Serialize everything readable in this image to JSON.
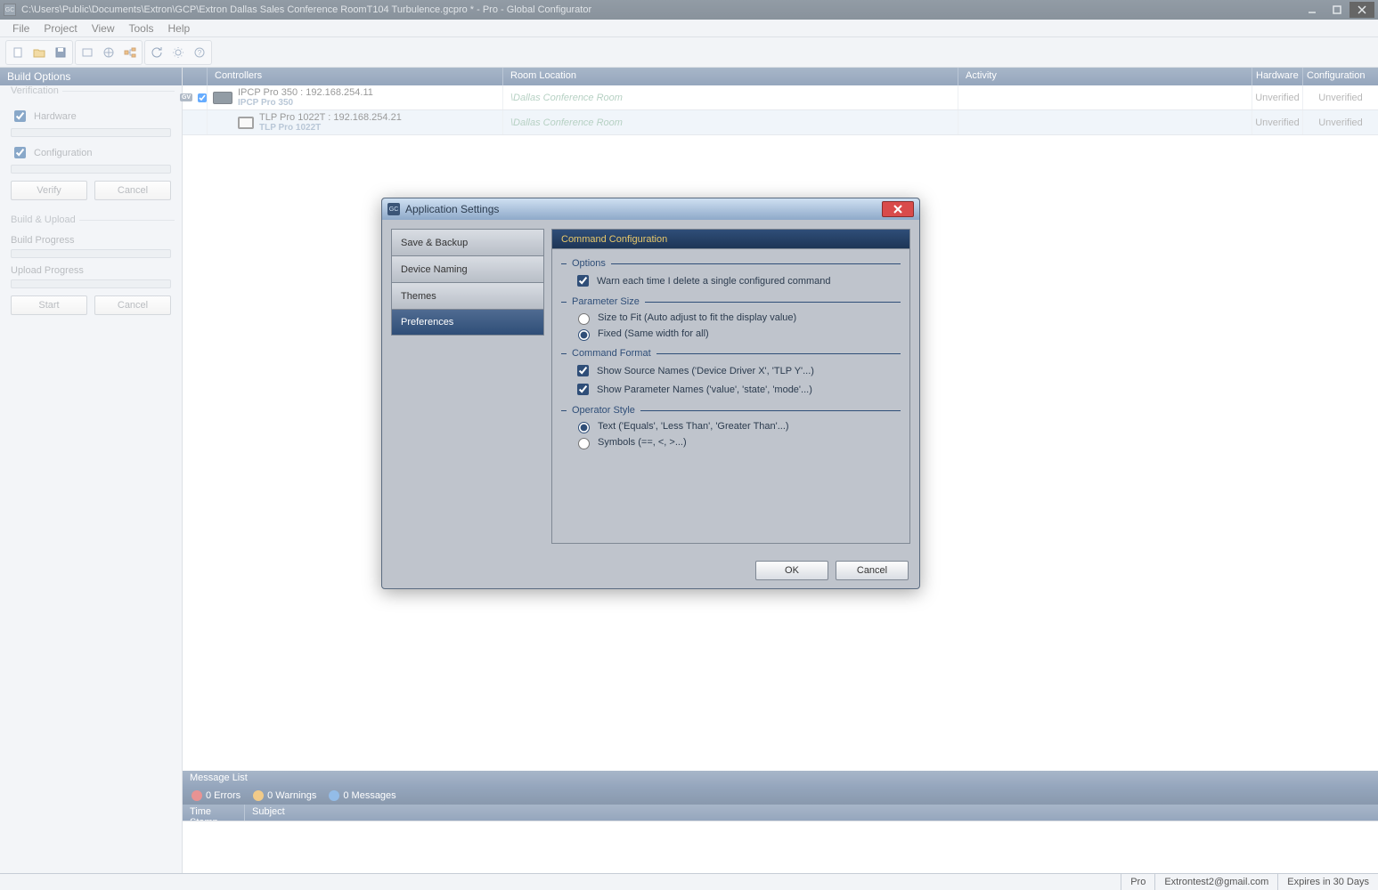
{
  "window": {
    "title": "C:\\Users\\Public\\Documents\\Extron\\GCP\\Extron Dallas Sales Conference RoomT104 Turbulence.gcpro * - Pro - Global Configurator"
  },
  "menu": [
    "File",
    "Project",
    "View",
    "Tools",
    "Help"
  ],
  "build_options": {
    "title": "Build Options",
    "verification_legend": "Verification",
    "hardware_label": "Hardware",
    "configuration_label": "Configuration",
    "verify_btn": "Verify",
    "cancel_btn": "Cancel",
    "build_upload_legend": "Build & Upload",
    "build_progress_label": "Build Progress",
    "upload_progress_label": "Upload Progress",
    "start_btn": "Start",
    "cancel2_btn": "Cancel"
  },
  "controllers": {
    "headers": {
      "controllers": "Controllers",
      "room": "Room Location",
      "activity": "Activity",
      "hardware": "Hardware",
      "configuration": "Configuration"
    },
    "rows": [
      {
        "gv_badge": "GV",
        "line1": "IPCP Pro 350 : 192.168.254.11",
        "line2": "IPCP Pro 350",
        "room": "\\Dallas Conference Room",
        "hardware": "Unverified",
        "configuration": "Unverified"
      },
      {
        "line1": "TLP Pro 1022T : 192.168.254.21",
        "line2": "TLP Pro 1022T",
        "room": "\\Dallas Conference Room",
        "hardware": "Unverified",
        "configuration": "Unverified"
      }
    ]
  },
  "message_list": {
    "title": "Message List",
    "errors": "0 Errors",
    "warnings": "0 Warnings",
    "messages": "0 Messages",
    "cols": {
      "timestamp": "Time Stamp",
      "subject": "Subject"
    }
  },
  "status": {
    "edition": "Pro",
    "user": "Extrontest2@gmail.com",
    "expires": "Expires in 30 Days"
  },
  "dialog": {
    "title": "Application Settings",
    "nav": [
      "Save & Backup",
      "Device Naming",
      "Themes",
      "Preferences"
    ],
    "selected_nav_index": 3,
    "content_header": "Command Configuration",
    "groups": {
      "options": {
        "title": "Options",
        "warn_delete": "Warn each time I delete a single configured command"
      },
      "parameter_size": {
        "title": "Parameter Size",
        "size_to_fit": "Size to Fit (Auto adjust to fit the display value)",
        "fixed": "Fixed (Same width for all)"
      },
      "command_format": {
        "title": "Command Format",
        "show_source": "Show Source Names ('Device Driver X', 'TLP Y'...)",
        "show_param": "Show Parameter Names ('value', 'state', 'mode'...)"
      },
      "operator_style": {
        "title": "Operator Style",
        "text": "Text ('Equals', 'Less Than', 'Greater Than'...)",
        "symbols": "Symbols (==, <, >...)"
      }
    },
    "ok": "OK",
    "cancel": "Cancel"
  }
}
